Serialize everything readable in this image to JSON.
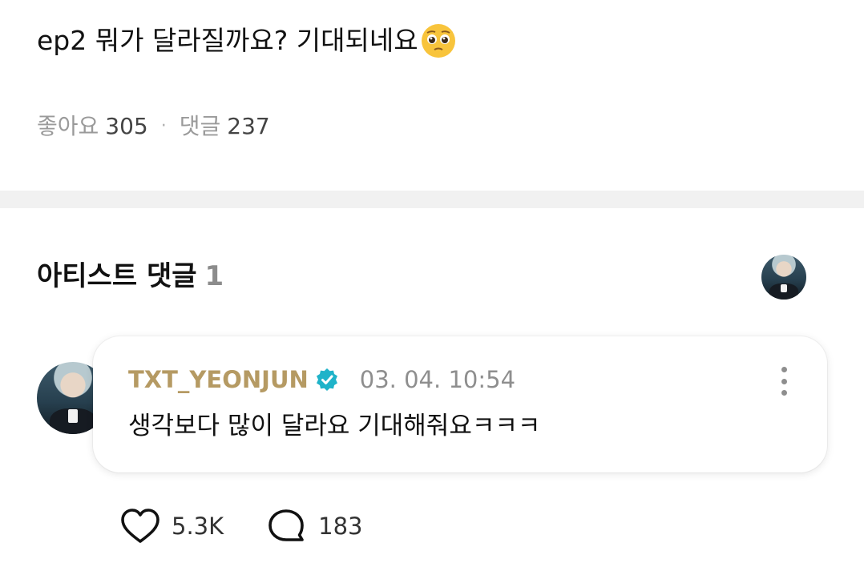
{
  "post": {
    "text": "ep2 뭐가 달라질까요? 기대되네요",
    "emoji_icon": "pleading-face-icon",
    "likes_label": "좋아요",
    "likes_count": "305",
    "separator": "·",
    "comments_label": "댓글",
    "comments_count": "237"
  },
  "artist_section": {
    "title": "아티스트 댓글",
    "count": "1"
  },
  "comment": {
    "author": "TXT_YEONJUN",
    "verified_icon": "verified-badge-icon",
    "timestamp": "03. 04. 10:54",
    "text": "생각보다 많이 달라요 기대해줘요ㅋㅋㅋ",
    "menu_icon": "more-vertical-icon",
    "like_count": "5.3K",
    "reply_count": "183"
  },
  "colors": {
    "author": "#b59a63",
    "verified": "#1fb3c9",
    "divider": "#f1f1f1",
    "muted": "#9a9a9a"
  }
}
